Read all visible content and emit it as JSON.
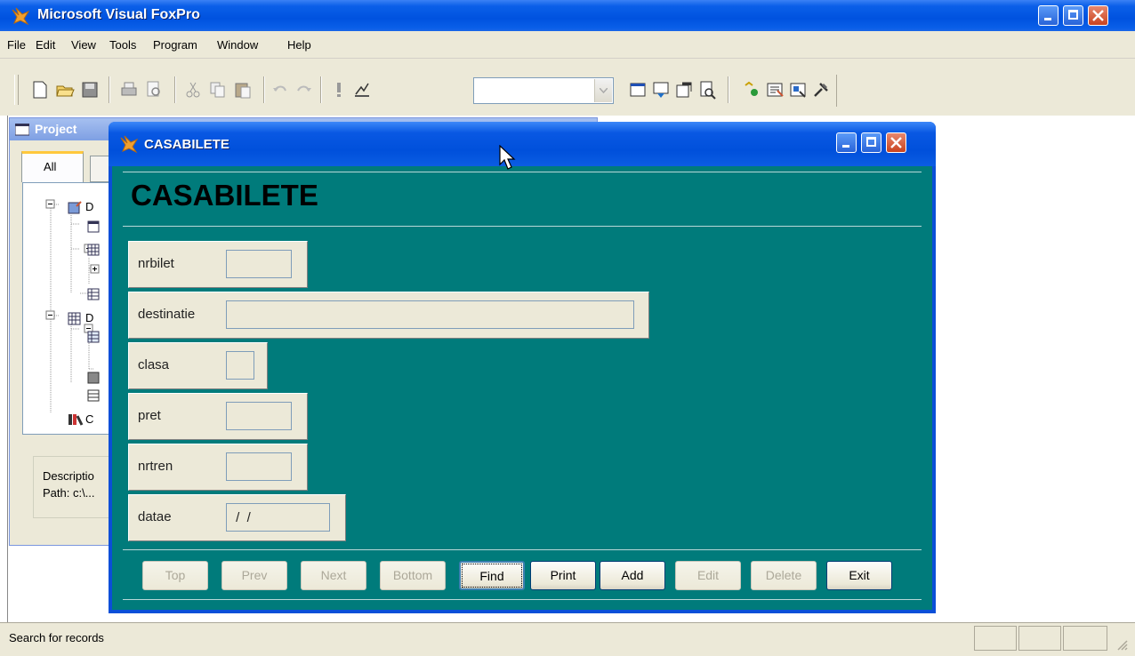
{
  "app": {
    "title": "Microsoft Visual FoxPro"
  },
  "menu": [
    "File",
    "Edit",
    "View",
    "Tools",
    "Program",
    "Window",
    "Help"
  ],
  "toolbar": {
    "combo_value": ""
  },
  "project_manager": {
    "title": "Project",
    "tab_all": "All",
    "tree_items": [
      "D",
      "D",
      "C"
    ],
    "description_label": "Descriptio",
    "path_label": "Path: c:\\..."
  },
  "form": {
    "window_title": "CASABILETE",
    "heading": "CASABILETE",
    "fields": [
      {
        "label": "nrbilet",
        "value": ""
      },
      {
        "label": "destinatie",
        "value": ""
      },
      {
        "label": "clasa",
        "value": ""
      },
      {
        "label": "pret",
        "value": ""
      },
      {
        "label": "nrtren",
        "value": ""
      },
      {
        "label": "datae",
        "value": " /  /"
      }
    ],
    "buttons": {
      "top": "Top",
      "prev": "Prev",
      "next": "Next",
      "bottom": "Bottom",
      "find": "Find",
      "print": "Print",
      "add": "Add",
      "edit": "Edit",
      "delete": "Delete",
      "exit": "Exit"
    }
  },
  "status": {
    "text": "Search for records"
  }
}
